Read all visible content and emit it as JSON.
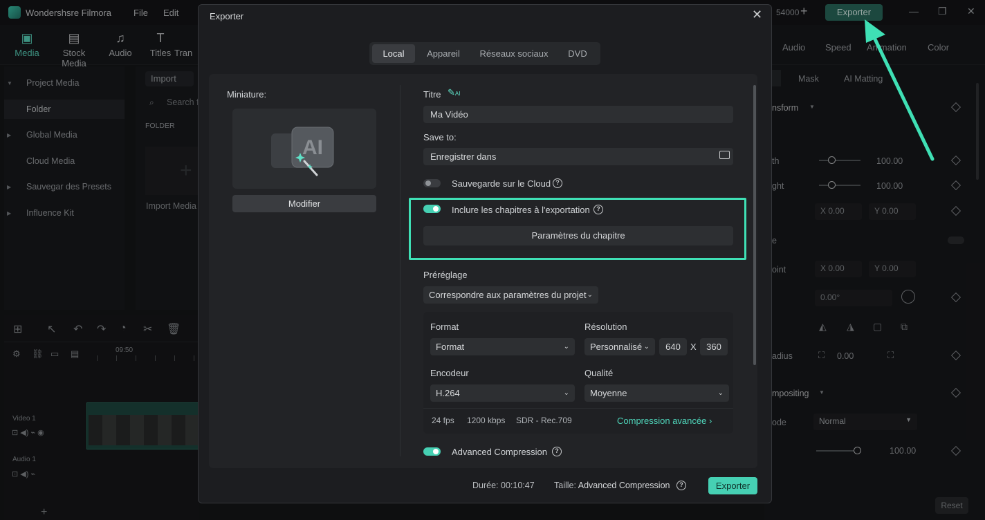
{
  "app": {
    "title": "Wondershsre Filmora",
    "menu": [
      "File",
      "Edit"
    ],
    "credits": "54000",
    "export_button": "Exporter"
  },
  "toolbar": {
    "items": [
      {
        "label": "Media",
        "icon": "media-icon"
      },
      {
        "label": "Stock Media",
        "icon": "stock-media-icon"
      },
      {
        "label": "Audio",
        "icon": "audio-icon"
      },
      {
        "label": "Titles",
        "icon": "titles-icon"
      },
      {
        "label": "Tran",
        "icon": "transitions-icon"
      }
    ],
    "right_tabs": [
      "Audio",
      "Speed",
      "Animation",
      "Color"
    ]
  },
  "left_panel": {
    "items": [
      "Project Media",
      "Folder",
      "Global Media",
      "Cloud Media",
      "Sauvegar des Presets",
      "Influence Kit"
    ],
    "import_label": "Import",
    "search_placeholder": "Search f",
    "folder_header": "FOLDER",
    "import_media": "Import Media"
  },
  "timeline": {
    "timecode": "09:50",
    "video_track": "Video 1",
    "audio_track": "Audio 1"
  },
  "right_panel": {
    "tabs": [
      "Mask",
      "AI Matting"
    ],
    "transform": "nsform",
    "width_label": "th",
    "height_label": "ght",
    "width_value": "100.00",
    "height_value": "100.00",
    "pos_x": "0.00",
    "pos_y": "0.00",
    "x_label": "X",
    "y_label": "Y",
    "point_label": "oint",
    "point_x": "0.00",
    "point_y": "0.00",
    "rotate_label": "e",
    "rotate_value": "0.00°",
    "radius_label": "adius",
    "radius_value": "0.00",
    "compositing": "mpositing",
    "mode_label": "ode",
    "mode_value": "Normal",
    "opacity_value": "100.00",
    "reset": "Reset"
  },
  "dialog": {
    "title": "Exporter",
    "tabs": [
      "Local",
      "Appareil",
      "Réseaux sociaux",
      "DVD"
    ],
    "thumbnail_label": "Miniature:",
    "modify_button": "Modifier",
    "title_label": "Titre",
    "title_value": "Ma Vidéo",
    "save_to_label": "Save to:",
    "save_to_value": "Enregistrer dans",
    "cloud_backup": "Sauvegarde sur le Cloud",
    "include_chapters": "Inclure les chapitres à l'exportation",
    "chapter_settings": "Paramètres du chapitre",
    "preset_label": "Préréglage",
    "preset_value": "Correspondre aux paramètres du projet",
    "format_label": "Format",
    "format_value": "Format",
    "resolution_label": "Résolution",
    "resolution_value": "Personnalisé",
    "res_width": "640",
    "res_x": "X",
    "res_height": "360",
    "encoder_label": "Encodeur",
    "encoder_value": "H.264",
    "quality_label": "Qualité",
    "quality_value": "Moyenne",
    "fps": "24 fps",
    "bitrate": "1200 kbps",
    "color": "SDR - Rec.709",
    "advanced_link": "Compression avancée",
    "advanced_compression": "Advanced Compression",
    "duration_label": "Durée:",
    "duration_value": "00:10:47",
    "size_label": "Taille:",
    "size_value": "Advanced Compression",
    "export_button": "Exporter",
    "cloud_backup_on": false,
    "include_chapters_on": true,
    "advanced_compression_on": true
  },
  "colors": {
    "accent": "#46d0b3",
    "highlight": "#3fe0b5"
  }
}
